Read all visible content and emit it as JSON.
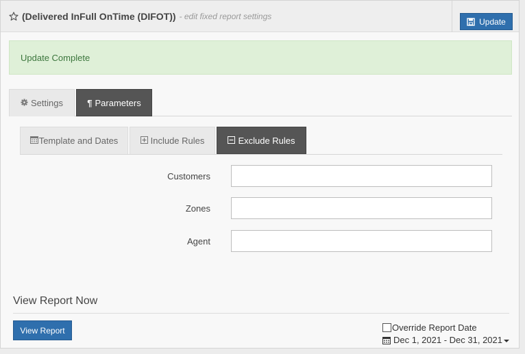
{
  "header": {
    "title": "(Delivered InFull OnTime (DIFOT))",
    "subtitle": "- edit fixed report settings",
    "update_label": "Update"
  },
  "alert": {
    "message": "Update Complete"
  },
  "tabs": [
    {
      "label": "Settings",
      "icon": "gear-icon",
      "active": false
    },
    {
      "label": "Parameters",
      "icon": "pilcrow-icon",
      "active": true
    }
  ],
  "subtabs": [
    {
      "label": "Template and Dates",
      "icon": "calendar-icon",
      "active": false
    },
    {
      "label": "Include Rules",
      "icon": "plus-square-icon",
      "active": false
    },
    {
      "label": "Exclude Rules",
      "icon": "minus-square-icon",
      "active": true
    }
  ],
  "form": {
    "fields": [
      {
        "label": "Customers",
        "value": ""
      },
      {
        "label": "Zones",
        "value": ""
      },
      {
        "label": "Agent",
        "value": ""
      }
    ]
  },
  "view_report": {
    "section_title": "View Report Now",
    "button_label": "View Report",
    "override_label": "Override Report Date",
    "override_checked": false,
    "date_range": "Dec 1, 2021 - Dec 31, 2021"
  },
  "colors": {
    "primary_button": "#2f6fad",
    "active_tab": "#555555",
    "alert_bg": "#dff0d8",
    "alert_text": "#3c763d"
  }
}
